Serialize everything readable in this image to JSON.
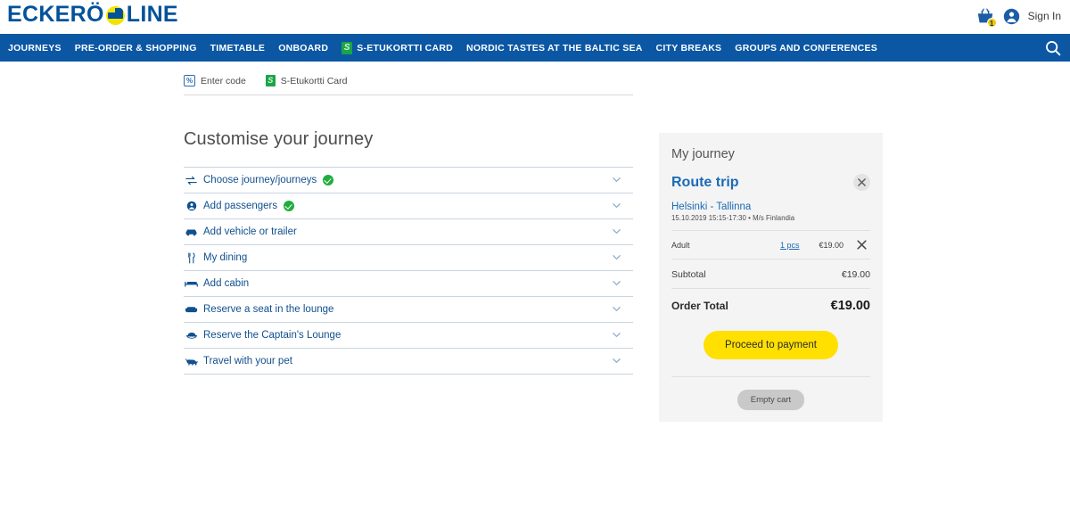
{
  "brand": {
    "name_left": "ECKERÖ",
    "name_right": "LINE",
    "primary_blue": "#0b57a4",
    "logo_blue": "#00529b",
    "logo_yellow": "#f2e300",
    "accent_yellow": "#ffe000",
    "success_green": "#21ad3e"
  },
  "topbar": {
    "cart_icon": "shopping-basket-icon",
    "cart_badge": "1",
    "user_icon": "user-avatar-icon",
    "signin_label": "Sign In"
  },
  "nav": {
    "items": [
      {
        "label": "JOURNEYS",
        "icon": null
      },
      {
        "label": "PRE-ORDER & SHOPPING",
        "icon": null
      },
      {
        "label": "TIMETABLE",
        "icon": null
      },
      {
        "label": "ONBOARD",
        "icon": null
      },
      {
        "label": "S-ETUKORTTI CARD",
        "icon": "s-card-icon"
      },
      {
        "label": "NORDIC TASTES AT THE BALTIC SEA",
        "icon": null
      },
      {
        "label": "CITY BREAKS",
        "icon": null
      },
      {
        "label": "GROUPS AND CONFERENCES",
        "icon": null
      }
    ],
    "search_icon": "search-icon"
  },
  "codebar": {
    "enter_code_label": "Enter code",
    "enter_code_icon": "percent-icon",
    "percent_glyph": "%",
    "s_card_label": "S-Etukortti Card",
    "s_card_icon": "s-card-icon"
  },
  "main": {
    "title": "Customise your journey",
    "accordions": [
      {
        "label": "Choose journey/journeys",
        "icon": "exchange-arrows-icon",
        "completed": true
      },
      {
        "label": "Add passengers",
        "icon": "person-icon",
        "completed": true
      },
      {
        "label": "Add vehicle or trailer",
        "icon": "car-icon",
        "completed": false
      },
      {
        "label": "My dining",
        "icon": "cutlery-icon",
        "completed": false
      },
      {
        "label": "Add cabin",
        "icon": "bed-icon",
        "completed": false
      },
      {
        "label": "Reserve a seat in the lounge",
        "icon": "sofa-icon",
        "completed": false
      },
      {
        "label": "Reserve the Captain's Lounge",
        "icon": "captain-hat-icon",
        "completed": false
      },
      {
        "label": "Travel with your pet",
        "icon": "dog-icon",
        "completed": false
      }
    ],
    "chevron_icon": "chevron-down-icon"
  },
  "journey_panel": {
    "title": "My journey",
    "route_title": "Route trip",
    "remove_trip_icon": "close-icon",
    "trip": {
      "route": "Helsinki - Tallinna",
      "details": "15.10.2019 15:15-17:30 • M/s Finlandia"
    },
    "passengers": [
      {
        "type": "Adult",
        "quantity": "1 pcs",
        "price": "€19.00",
        "remove_icon": "close-icon"
      }
    ],
    "subtotal_label": "Subtotal",
    "subtotal_value": "€19.00",
    "total_label": "Order Total",
    "total_value": "€19.00",
    "proceed_label": "Proceed to payment",
    "empty_cart_label": "Empty cart"
  }
}
